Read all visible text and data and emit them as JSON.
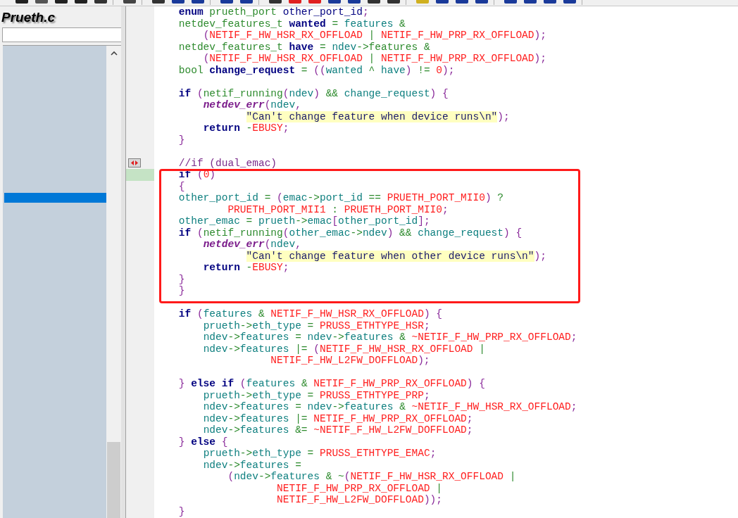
{
  "sidebar": {
    "title": "Prueth.c"
  },
  "code": {
    "lines": [
      {
        "marked": false,
        "highlighted": false,
        "parts": [
          {
            "kind": "kw",
            "text": "    enum"
          },
          {
            "kind": "type",
            "text": " prueth_port"
          },
          {
            "kind": "name",
            "text": " other_port_id"
          },
          {
            "kind": "p",
            "text": ";"
          }
        ]
      },
      {
        "marked": false,
        "highlighted": false,
        "parts": [
          {
            "kind": "type",
            "text": "    netdev_features_t"
          },
          {
            "kind": "kw",
            "text": " wanted"
          },
          {
            "kind": "op",
            "text": " ="
          },
          {
            "kind": "id",
            "text": " features"
          },
          {
            "kind": "op",
            "text": " &"
          }
        ]
      },
      {
        "marked": false,
        "highlighted": false,
        "parts": [
          {
            "kind": "p",
            "text": "        ("
          },
          {
            "kind": "const",
            "text": "NETIF_F_HW_HSR_RX_OFFLOAD"
          },
          {
            "kind": "op",
            "text": " |"
          },
          {
            "kind": "const",
            "text": " NETIF_F_HW_PRP_RX_OFFLOAD"
          },
          {
            "kind": "p",
            "text": ");"
          }
        ]
      },
      {
        "marked": false,
        "highlighted": false,
        "parts": [
          {
            "kind": "type",
            "text": "    netdev_features_t"
          },
          {
            "kind": "kw",
            "text": " have"
          },
          {
            "kind": "op",
            "text": " ="
          },
          {
            "kind": "id",
            "text": " ndev"
          },
          {
            "kind": "op",
            "text": "->features &"
          }
        ]
      },
      {
        "marked": false,
        "highlighted": false,
        "parts": [
          {
            "kind": "p",
            "text": "        ("
          },
          {
            "kind": "const",
            "text": "NETIF_F_HW_HSR_RX_OFFLOAD"
          },
          {
            "kind": "op",
            "text": " |"
          },
          {
            "kind": "const",
            "text": " NETIF_F_HW_PRP_RX_OFFLOAD"
          },
          {
            "kind": "p",
            "text": ");"
          }
        ]
      },
      {
        "marked": false,
        "highlighted": false,
        "parts": [
          {
            "kind": "type",
            "text": "    bool"
          },
          {
            "kind": "kw",
            "text": " change_request"
          },
          {
            "kind": "op",
            "text": " ="
          },
          {
            "kind": "p",
            "text": " (("
          },
          {
            "kind": "id",
            "text": "wanted"
          },
          {
            "kind": "op",
            "text": " ^"
          },
          {
            "kind": "id",
            "text": " have"
          },
          {
            "kind": "p",
            "text": ")"
          },
          {
            "kind": "op",
            "text": " !="
          },
          {
            "kind": "const",
            "text": " 0"
          },
          {
            "kind": "p",
            "text": ");"
          }
        ]
      },
      {
        "marked": false,
        "highlighted": false
      },
      {
        "marked": false,
        "highlighted": false,
        "parts": [
          {
            "kind": "kw",
            "text": "    if"
          },
          {
            "kind": "p",
            "text": " ("
          },
          {
            "kind": "type",
            "text": "netif_running"
          },
          {
            "kind": "p",
            "text": "("
          },
          {
            "kind": "id",
            "text": "ndev"
          },
          {
            "kind": "p",
            "text": ")"
          },
          {
            "kind": "op",
            "text": " &&"
          },
          {
            "kind": "id",
            "text": " change_request"
          },
          {
            "kind": "p",
            "text": ") {"
          }
        ]
      },
      {
        "marked": false,
        "highlighted": false,
        "parts": [
          {
            "kind": "fn",
            "text": "        netdev_err"
          },
          {
            "kind": "p",
            "text": "("
          },
          {
            "kind": "id",
            "text": "ndev"
          },
          {
            "kind": "p",
            "text": ","
          }
        ]
      },
      {
        "marked": false,
        "highlighted": false,
        "parts": [
          {
            "kind": "str",
            "text": "               \"Can't change feature when device runs\\n\""
          },
          {
            "kind": "p",
            "text": ");"
          }
        ]
      },
      {
        "marked": false,
        "highlighted": false,
        "parts": [
          {
            "kind": "kw",
            "text": "        return"
          },
          {
            "kind": "op",
            "text": " -"
          },
          {
            "kind": "const",
            "text": "EBUSY"
          },
          {
            "kind": "p",
            "text": ";"
          }
        ]
      },
      {
        "marked": false,
        "highlighted": false,
        "parts": [
          {
            "kind": "p",
            "text": "    }"
          }
        ]
      },
      {
        "marked": false,
        "highlighted": false
      },
      {
        "marked": true,
        "highlighted": false,
        "parts": [
          {
            "kind": "cm",
            "text": "    //if (dual_emac)"
          }
        ]
      },
      {
        "marked": false,
        "highlighted": true,
        "parts": [
          {
            "kind": "kw",
            "text": "    if"
          },
          {
            "kind": "p",
            "text": " ("
          },
          {
            "kind": "const",
            "text": "0"
          },
          {
            "kind": "p",
            "text": ")"
          }
        ]
      },
      {
        "marked": false,
        "highlighted": false,
        "parts": [
          {
            "kind": "p",
            "text": "    {"
          }
        ]
      },
      {
        "marked": false,
        "highlighted": false,
        "parts": [
          {
            "kind": "id",
            "text": "    other_port_id"
          },
          {
            "kind": "op",
            "text": " ="
          },
          {
            "kind": "p",
            "text": " ("
          },
          {
            "kind": "id",
            "text": "emac"
          },
          {
            "kind": "op",
            "text": "->"
          },
          {
            "kind": "id",
            "text": "port_id"
          },
          {
            "kind": "op",
            "text": " =="
          },
          {
            "kind": "const",
            "text": " PRUETH_PORT_MII0"
          },
          {
            "kind": "p",
            "text": ")"
          },
          {
            "kind": "op",
            "text": " ?"
          }
        ]
      },
      {
        "marked": false,
        "highlighted": false,
        "parts": [
          {
            "kind": "const",
            "text": "            PRUETH_PORT_MII1"
          },
          {
            "kind": "op",
            "text": " :"
          },
          {
            "kind": "const",
            "text": " PRUETH_PORT_MII0"
          },
          {
            "kind": "p",
            "text": ";"
          }
        ]
      },
      {
        "marked": false,
        "highlighted": false,
        "parts": [
          {
            "kind": "id",
            "text": "    other_emac"
          },
          {
            "kind": "op",
            "text": " ="
          },
          {
            "kind": "id",
            "text": " prueth"
          },
          {
            "kind": "op",
            "text": "->"
          },
          {
            "kind": "id",
            "text": "emac"
          },
          {
            "kind": "p",
            "text": "["
          },
          {
            "kind": "id",
            "text": "other_port_id"
          },
          {
            "kind": "p",
            "text": "];"
          }
        ]
      },
      {
        "marked": false,
        "highlighted": false,
        "parts": [
          {
            "kind": "kw",
            "text": "    if"
          },
          {
            "kind": "p",
            "text": " ("
          },
          {
            "kind": "type",
            "text": "netif_running"
          },
          {
            "kind": "p",
            "text": "("
          },
          {
            "kind": "id",
            "text": "other_emac"
          },
          {
            "kind": "op",
            "text": "->"
          },
          {
            "kind": "id",
            "text": "ndev"
          },
          {
            "kind": "p",
            "text": ")"
          },
          {
            "kind": "op",
            "text": " &&"
          },
          {
            "kind": "id",
            "text": " change_request"
          },
          {
            "kind": "p",
            "text": ") {"
          }
        ]
      },
      {
        "marked": false,
        "highlighted": false,
        "parts": [
          {
            "kind": "fn",
            "text": "        netdev_err"
          },
          {
            "kind": "p",
            "text": "("
          },
          {
            "kind": "id",
            "text": "ndev"
          },
          {
            "kind": "p",
            "text": ","
          }
        ]
      },
      {
        "marked": false,
        "highlighted": false,
        "parts": [
          {
            "kind": "str",
            "text": "               \"Can't change feature when other device runs\\n\""
          },
          {
            "kind": "p",
            "text": ");"
          }
        ]
      },
      {
        "marked": false,
        "highlighted": false,
        "parts": [
          {
            "kind": "kw",
            "text": "        return"
          },
          {
            "kind": "op",
            "text": " -"
          },
          {
            "kind": "const",
            "text": "EBUSY"
          },
          {
            "kind": "p",
            "text": ";"
          }
        ]
      },
      {
        "marked": false,
        "highlighted": false,
        "parts": [
          {
            "kind": "p",
            "text": "    }"
          }
        ]
      },
      {
        "marked": false,
        "highlighted": false,
        "parts": [
          {
            "kind": "p",
            "text": "    }"
          }
        ]
      },
      {
        "marked": false,
        "highlighted": false
      },
      {
        "marked": false,
        "highlighted": false,
        "parts": [
          {
            "kind": "kw",
            "text": "    if"
          },
          {
            "kind": "p",
            "text": " ("
          },
          {
            "kind": "id",
            "text": "features"
          },
          {
            "kind": "op",
            "text": " &"
          },
          {
            "kind": "const",
            "text": " NETIF_F_HW_HSR_RX_OFFLOAD"
          },
          {
            "kind": "p",
            "text": ") {"
          }
        ]
      },
      {
        "marked": false,
        "highlighted": false,
        "parts": [
          {
            "kind": "id",
            "text": "        prueth"
          },
          {
            "kind": "op",
            "text": "->"
          },
          {
            "kind": "id",
            "text": "eth_type"
          },
          {
            "kind": "op",
            "text": " ="
          },
          {
            "kind": "const",
            "text": " PRUSS_ETHTYPE_HSR"
          },
          {
            "kind": "p",
            "text": ";"
          }
        ]
      },
      {
        "marked": false,
        "highlighted": false,
        "parts": [
          {
            "kind": "id",
            "text": "        ndev"
          },
          {
            "kind": "op",
            "text": "->"
          },
          {
            "kind": "id",
            "text": "features"
          },
          {
            "kind": "op",
            "text": " ="
          },
          {
            "kind": "id",
            "text": " ndev"
          },
          {
            "kind": "op",
            "text": "->"
          },
          {
            "kind": "id",
            "text": "features"
          },
          {
            "kind": "op",
            "text": " &"
          },
          {
            "kind": "const",
            "text": " ~NETIF_F_HW_PRP_RX_OFFLOAD"
          },
          {
            "kind": "p",
            "text": ";"
          }
        ]
      },
      {
        "marked": false,
        "highlighted": false,
        "parts": [
          {
            "kind": "id",
            "text": "        ndev"
          },
          {
            "kind": "op",
            "text": "->"
          },
          {
            "kind": "id",
            "text": "features"
          },
          {
            "kind": "op",
            "text": " |="
          },
          {
            "kind": "p",
            "text": " ("
          },
          {
            "kind": "const",
            "text": "NETIF_F_HW_HSR_RX_OFFLOAD"
          },
          {
            "kind": "op",
            "text": " |"
          }
        ]
      },
      {
        "marked": false,
        "highlighted": false,
        "parts": [
          {
            "kind": "const",
            "text": "                   NETIF_F_HW_L2FW_DOFFLOAD"
          },
          {
            "kind": "p",
            "text": ");"
          }
        ]
      },
      {
        "marked": false,
        "highlighted": false
      },
      {
        "marked": false,
        "highlighted": false,
        "parts": [
          {
            "kind": "p",
            "text": "    }"
          },
          {
            "kind": "kw",
            "text": " else if"
          },
          {
            "kind": "p",
            "text": " ("
          },
          {
            "kind": "id",
            "text": "features"
          },
          {
            "kind": "op",
            "text": " &"
          },
          {
            "kind": "const",
            "text": " NETIF_F_HW_PRP_RX_OFFLOAD"
          },
          {
            "kind": "p",
            "text": ") {"
          }
        ]
      },
      {
        "marked": false,
        "highlighted": false,
        "parts": [
          {
            "kind": "id",
            "text": "        prueth"
          },
          {
            "kind": "op",
            "text": "->"
          },
          {
            "kind": "id",
            "text": "eth_type"
          },
          {
            "kind": "op",
            "text": " ="
          },
          {
            "kind": "const",
            "text": " PRUSS_ETHTYPE_PRP"
          },
          {
            "kind": "p",
            "text": ";"
          }
        ]
      },
      {
        "marked": false,
        "highlighted": false,
        "parts": [
          {
            "kind": "id",
            "text": "        ndev"
          },
          {
            "kind": "op",
            "text": "->"
          },
          {
            "kind": "id",
            "text": "features"
          },
          {
            "kind": "op",
            "text": " ="
          },
          {
            "kind": "id",
            "text": " ndev"
          },
          {
            "kind": "op",
            "text": "->"
          },
          {
            "kind": "id",
            "text": "features"
          },
          {
            "kind": "op",
            "text": " &"
          },
          {
            "kind": "const",
            "text": " ~NETIF_F_HW_HSR_RX_OFFLOAD"
          },
          {
            "kind": "p",
            "text": ";"
          }
        ]
      },
      {
        "marked": false,
        "highlighted": false,
        "parts": [
          {
            "kind": "id",
            "text": "        ndev"
          },
          {
            "kind": "op",
            "text": "->"
          },
          {
            "kind": "id",
            "text": "features"
          },
          {
            "kind": "op",
            "text": " |="
          },
          {
            "kind": "const",
            "text": " NETIF_F_HW_PRP_RX_OFFLOAD"
          },
          {
            "kind": "p",
            "text": ";"
          }
        ]
      },
      {
        "marked": false,
        "highlighted": false,
        "parts": [
          {
            "kind": "id",
            "text": "        ndev"
          },
          {
            "kind": "op",
            "text": "->"
          },
          {
            "kind": "id",
            "text": "features"
          },
          {
            "kind": "op",
            "text": " &="
          },
          {
            "kind": "const",
            "text": " ~NETIF_F_HW_L2FW_DOFFLOAD"
          },
          {
            "kind": "p",
            "text": ";"
          }
        ]
      },
      {
        "marked": false,
        "highlighted": false,
        "parts": [
          {
            "kind": "p",
            "text": "    }"
          },
          {
            "kind": "kw",
            "text": " else"
          },
          {
            "kind": "p",
            "text": " {"
          }
        ]
      },
      {
        "marked": false,
        "highlighted": false,
        "parts": [
          {
            "kind": "id",
            "text": "        prueth"
          },
          {
            "kind": "op",
            "text": "->"
          },
          {
            "kind": "id",
            "text": "eth_type"
          },
          {
            "kind": "op",
            "text": " ="
          },
          {
            "kind": "const",
            "text": " PRUSS_ETHTYPE_EMAC"
          },
          {
            "kind": "p",
            "text": ";"
          }
        ]
      },
      {
        "marked": false,
        "highlighted": false,
        "parts": [
          {
            "kind": "id",
            "text": "        ndev"
          },
          {
            "kind": "op",
            "text": "->"
          },
          {
            "kind": "id",
            "text": "features"
          },
          {
            "kind": "op",
            "text": " ="
          }
        ]
      },
      {
        "marked": false,
        "highlighted": false,
        "parts": [
          {
            "kind": "p",
            "text": "            ("
          },
          {
            "kind": "id",
            "text": "ndev"
          },
          {
            "kind": "op",
            "text": "->"
          },
          {
            "kind": "id",
            "text": "features"
          },
          {
            "kind": "op",
            "text": " & ~"
          },
          {
            "kind": "p",
            "text": "("
          },
          {
            "kind": "const",
            "text": "NETIF_F_HW_HSR_RX_OFFLOAD"
          },
          {
            "kind": "op",
            "text": " |"
          }
        ]
      },
      {
        "marked": false,
        "highlighted": false,
        "parts": [
          {
            "kind": "const",
            "text": "                    NETIF_F_HW_PRP_RX_OFFLOAD"
          },
          {
            "kind": "op",
            "text": " |"
          }
        ]
      },
      {
        "marked": false,
        "highlighted": false,
        "parts": [
          {
            "kind": "const",
            "text": "                    NETIF_F_HW_L2FW_DOFFLOAD"
          },
          {
            "kind": "p",
            "text": "));"
          }
        ]
      },
      {
        "marked": false,
        "highlighted": false,
        "parts": [
          {
            "kind": "p",
            "text": "    }"
          }
        ]
      }
    ]
  }
}
